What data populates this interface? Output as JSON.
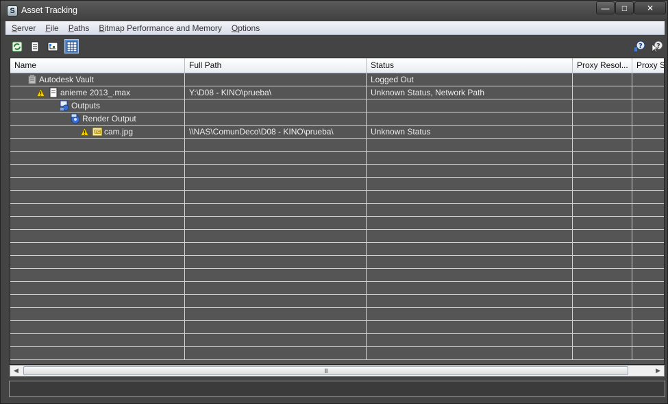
{
  "window": {
    "title": "Asset Tracking"
  },
  "menu": [
    "Server",
    "File",
    "Paths",
    "Bitmap Performance and Memory",
    "Options"
  ],
  "toolbar": {
    "icons": [
      "refresh-icon",
      "list-view-icon",
      "tree-view-icon",
      "table-view-icon"
    ],
    "right_icons": [
      "help-icon",
      "help-pointer-icon"
    ]
  },
  "table": {
    "columns": [
      "Name",
      "Full Path",
      "Status",
      "Proxy Resol...",
      "Proxy St"
    ],
    "rows": [
      {
        "name": "Autodesk Vault",
        "path": "",
        "status": "Logged Out"
      },
      {
        "name": "anieme 2013_.max",
        "path": "Y:\\D08 - KINO\\prueba\\",
        "status": "Unknown Status, Network Path"
      },
      {
        "name": "Outputs",
        "path": "",
        "status": ""
      },
      {
        "name": "Render Output",
        "path": "",
        "status": ""
      },
      {
        "name": "cam.jpg",
        "path": "\\\\NAS\\ComunDeco\\D08 - KINO\\prueba\\",
        "status": "Unknown Status"
      }
    ]
  },
  "scrollbar": {
    "grip": "III"
  }
}
